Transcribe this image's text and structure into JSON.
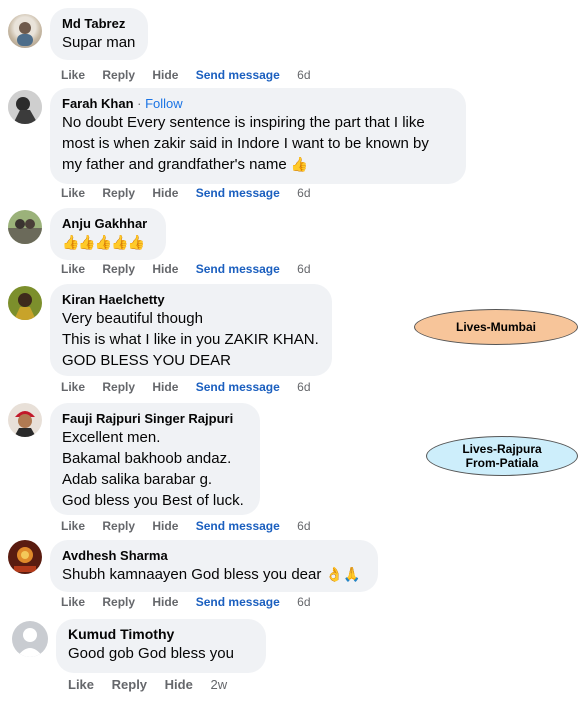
{
  "comments": [
    {
      "author": "Md Tabrez",
      "lines": [
        "Supar man"
      ],
      "actions": {
        "like": "Like",
        "reply": "Reply",
        "hide": "Hide",
        "send": "Send message",
        "age": "6d"
      }
    },
    {
      "author": "Farah Khan",
      "separator": "·",
      "follow": "Follow",
      "lines": [
        "No doubt Every sentence is inspiring the part that I like",
        "most is when zakir said in Indore I want to be known by",
        "my father and grandfather's name"
      ],
      "actions": {
        "like": "Like",
        "reply": "Reply",
        "hide": "Hide",
        "send": "Send message",
        "age": "6d"
      }
    },
    {
      "author": "Anju Gakhhar",
      "lines": [
        "👍👍👍👍👍"
      ],
      "actions": {
        "like": "Like",
        "reply": "Reply",
        "hide": "Hide",
        "send": "Send message",
        "age": "6d"
      }
    },
    {
      "author": "Kiran Haelchetty",
      "lines": [
        "Very beautiful though",
        "This is what I like in you ZAKIR KHAN.",
        "GOD BLESS YOU DEAR"
      ],
      "actions": {
        "like": "Like",
        "reply": "Reply",
        "hide": "Hide",
        "send": "Send message",
        "age": "6d"
      }
    },
    {
      "author": "Fauji Rajpuri Singer Rajpuri",
      "lines": [
        "Excellent men.",
        "Bakamal bakhoob andaz.",
        "Adab salika barabar g.",
        "God bless you Best of luck."
      ],
      "actions": {
        "like": "Like",
        "reply": "Reply",
        "hide": "Hide",
        "send": "Send message",
        "age": "6d"
      }
    },
    {
      "author": "Avdhesh Sharma",
      "lines": [
        "Shubh kamnaayen God bless you dear"
      ],
      "emoji": "👌🙏",
      "actions": {
        "like": "Like",
        "reply": "Reply",
        "hide": "Hide",
        "send": "Send message",
        "age": "6d"
      }
    },
    {
      "author": "Kumud Timothy",
      "lines": [
        "Good gob God bless you"
      ],
      "actions": {
        "like": "Like",
        "reply": "Reply",
        "hide": "Hide",
        "age": "2w"
      }
    }
  ],
  "annotations": {
    "mumbai": {
      "text": "Lives-Mumbai",
      "color": "#f7c59a"
    },
    "rajpura": {
      "line1": "Lives-Rajpura",
      "line2": "From-Patiala",
      "color": "#cdeefb"
    }
  },
  "emoji_inline": "👍",
  "icons": {
    "avatar_placeholder": "person-silhouette-icon"
  },
  "colors": {
    "bubble": "#f0f2f5",
    "action_gray": "#65676b",
    "send_blue": "#1b5fbf",
    "follow_blue": "#1b74e4"
  }
}
